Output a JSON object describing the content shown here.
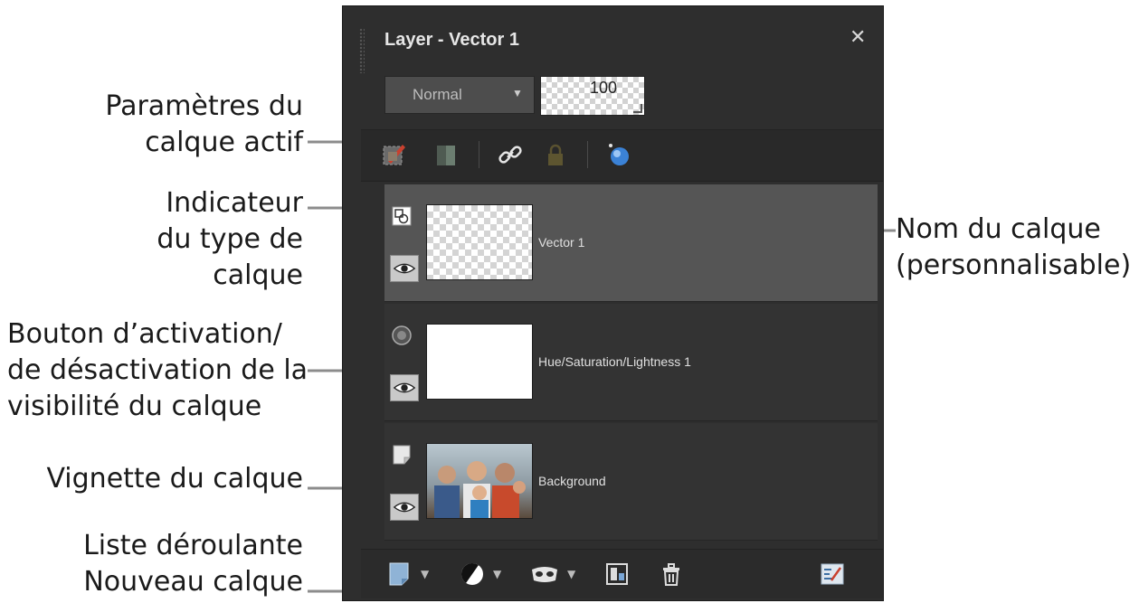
{
  "panel": {
    "title": "Layer - Vector 1",
    "close_symbol": "✕",
    "blend_mode": "Normal",
    "opacity": "100"
  },
  "toolbar": {
    "icons": [
      "layer-properties-icon",
      "mask-icon",
      "link-icon",
      "lock-icon",
      "effects-icon"
    ]
  },
  "layers": [
    {
      "name": "Vector 1",
      "type_icon": "vector-layer-icon",
      "selected": true,
      "visible": true,
      "thumb": "transparent"
    },
    {
      "name": "Hue/Saturation/Lightness 1",
      "type_icon": "adjustment-layer-icon",
      "selected": false,
      "visible": true,
      "thumb": "white"
    },
    {
      "name": "Background",
      "type_icon": "raster-layer-icon",
      "selected": false,
      "visible": true,
      "thumb": "photo"
    }
  ],
  "bottom_toolbar": {
    "icons": [
      "new-layer-icon",
      "adjustment-icon",
      "mask-icon",
      "merge-icon",
      "trash-icon",
      "layer-styles-icon"
    ]
  },
  "callouts": {
    "active_layer_settings": [
      "Paramètres du",
      "calque actif"
    ],
    "layer_type_indicator": [
      "Indicateur",
      "du type de",
      "calque"
    ],
    "layer_name": [
      "Nom du calque",
      "(personnalisable)"
    ],
    "visibility_toggle": [
      "Bouton d’activation/",
      "de désactivation de la",
      "visibilité du calque"
    ],
    "layer_thumbnail": [
      "Vignette du calque"
    ],
    "new_layer_dropdown": [
      "Liste déroulante",
      "Nouveau calque"
    ]
  },
  "colors": {
    "panel_bg": "#2e2e2e",
    "selected_row": "#555555",
    "accent_blue": "#3b82d6"
  }
}
